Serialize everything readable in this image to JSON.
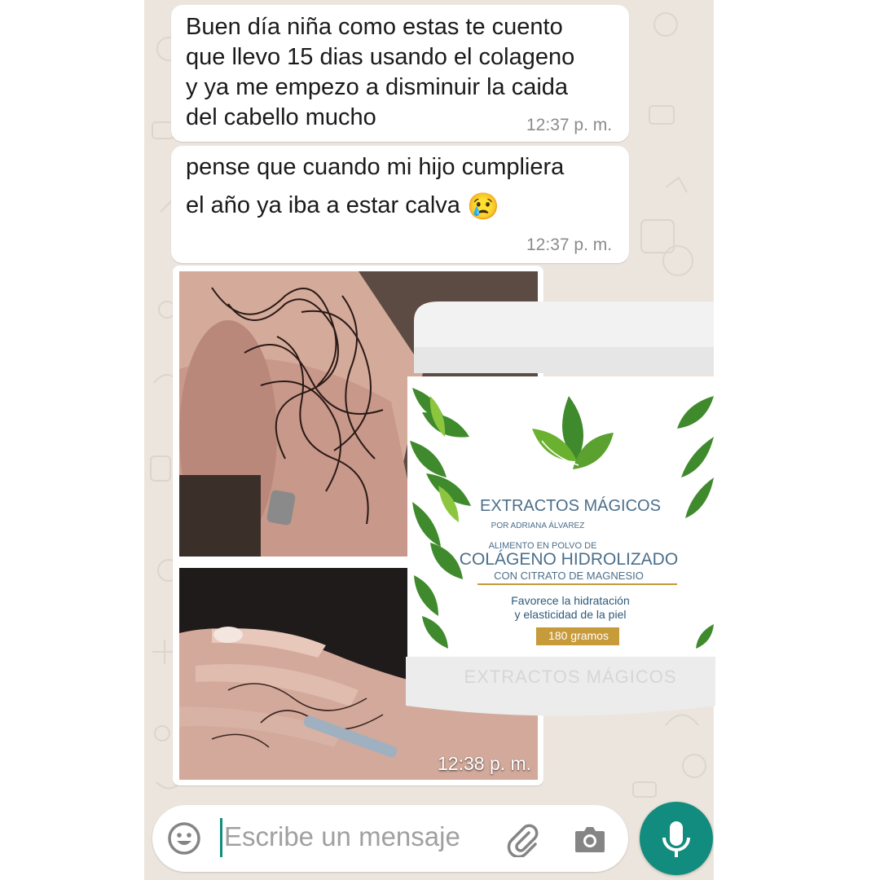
{
  "messages": [
    {
      "text_lines": [
        "Buen día niña como estas te cuento",
        "que llevo 15 dias usando el colageno",
        "y ya me empezo a disminuir la caida",
        "del cabello mucho"
      ],
      "time": "12:37 p. m."
    },
    {
      "text_lines": [
        "pense que cuando mi hijo cumpliera",
        "el año ya iba a estar calva"
      ],
      "emoji": "😢",
      "time": "12:37 p. m."
    },
    {
      "type": "photo",
      "time": "12:38 p. m."
    }
  ],
  "product": {
    "brand": "EXTRACTOS MÁGICOS",
    "byline": "POR ADRIANA ÁLVAREZ",
    "subtitle": "ALIMENTO EN POLVO DE",
    "name": "COLÁGENO HIDROLIZADO",
    "name_sub": "CON CITRATO DE MAGNESIO",
    "benefit_line1": "Favorece la hidratación",
    "benefit_line2": "y elasticidad de la piel",
    "weight": "180 gramos",
    "embossed": "EXTRACTOS MÁGICOS"
  },
  "input": {
    "placeholder": "Escribe un mensaje",
    "emoji_icon": "smiley-icon",
    "attach_icon": "paperclip-icon",
    "camera_icon": "camera-icon",
    "mic_icon": "microphone-icon"
  },
  "colors": {
    "wallpaper": "#ece5dd",
    "bubble": "#ffffff",
    "accent": "#128c7e",
    "jar_green": "#4c9a2a",
    "jar_text": "#4b6f8a",
    "gold": "#c79a3a"
  }
}
